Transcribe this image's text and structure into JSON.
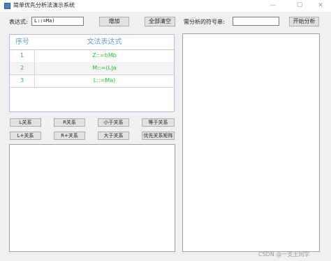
{
  "window": {
    "title": "简单优先分析法演示系统",
    "controls": {
      "minimize": "—",
      "maximize": "☐",
      "close": "✕"
    }
  },
  "top": {
    "expr_label": "表达式:",
    "expr_value": "L::=Ma)",
    "add_button": "增加",
    "clear_button": "全部清空",
    "input_label": "需分析的符号串:",
    "input_value": "",
    "start_button": "开始分析"
  },
  "grammar_table": {
    "headers": [
      "序号",
      "文法表达式"
    ],
    "rows": [
      {
        "index": "1",
        "expr": "Z::=bMb"
      },
      {
        "index": "2",
        "expr": "M::=(L|a"
      },
      {
        "index": "3",
        "expr": "L::=Ma)"
      }
    ]
  },
  "relation_buttons": {
    "row1": [
      "L关系",
      "R关系",
      "小于关系",
      "等于关系"
    ],
    "row2": [
      "L+关系",
      "R+关系",
      "大于关系",
      "优先关系矩阵"
    ]
  },
  "watermark": "CSDN @一支王同学"
}
